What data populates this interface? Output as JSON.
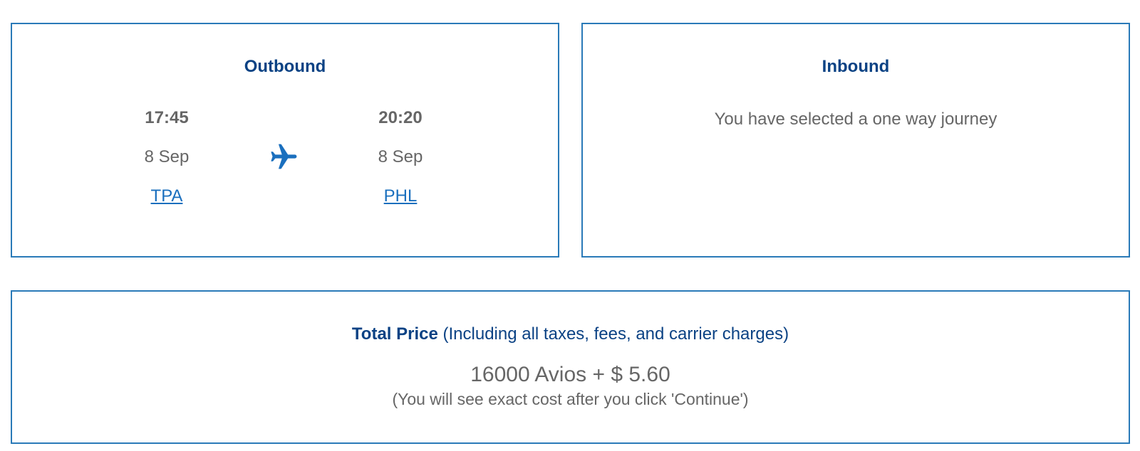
{
  "outbound": {
    "title": "Outbound",
    "departure": {
      "time": "17:45",
      "date": "8 Sep",
      "airport": "TPA"
    },
    "arrival": {
      "time": "20:20",
      "date": "8 Sep",
      "airport": "PHL"
    },
    "icon": "airplane-icon"
  },
  "inbound": {
    "title": "Inbound",
    "message": "You have selected a one way journey"
  },
  "price": {
    "label": "Total Price",
    "label_note": " (Including all taxes, fees, and carrier charges)",
    "value": "16000 Avios + $ 5.60",
    "note": "(You will see exact cost after you click 'Continue')"
  },
  "colors": {
    "border": "#2a7ab8",
    "heading": "#0b4284",
    "link": "#1a6fbe",
    "text": "#666666",
    "icon": "#1a6fbe"
  }
}
